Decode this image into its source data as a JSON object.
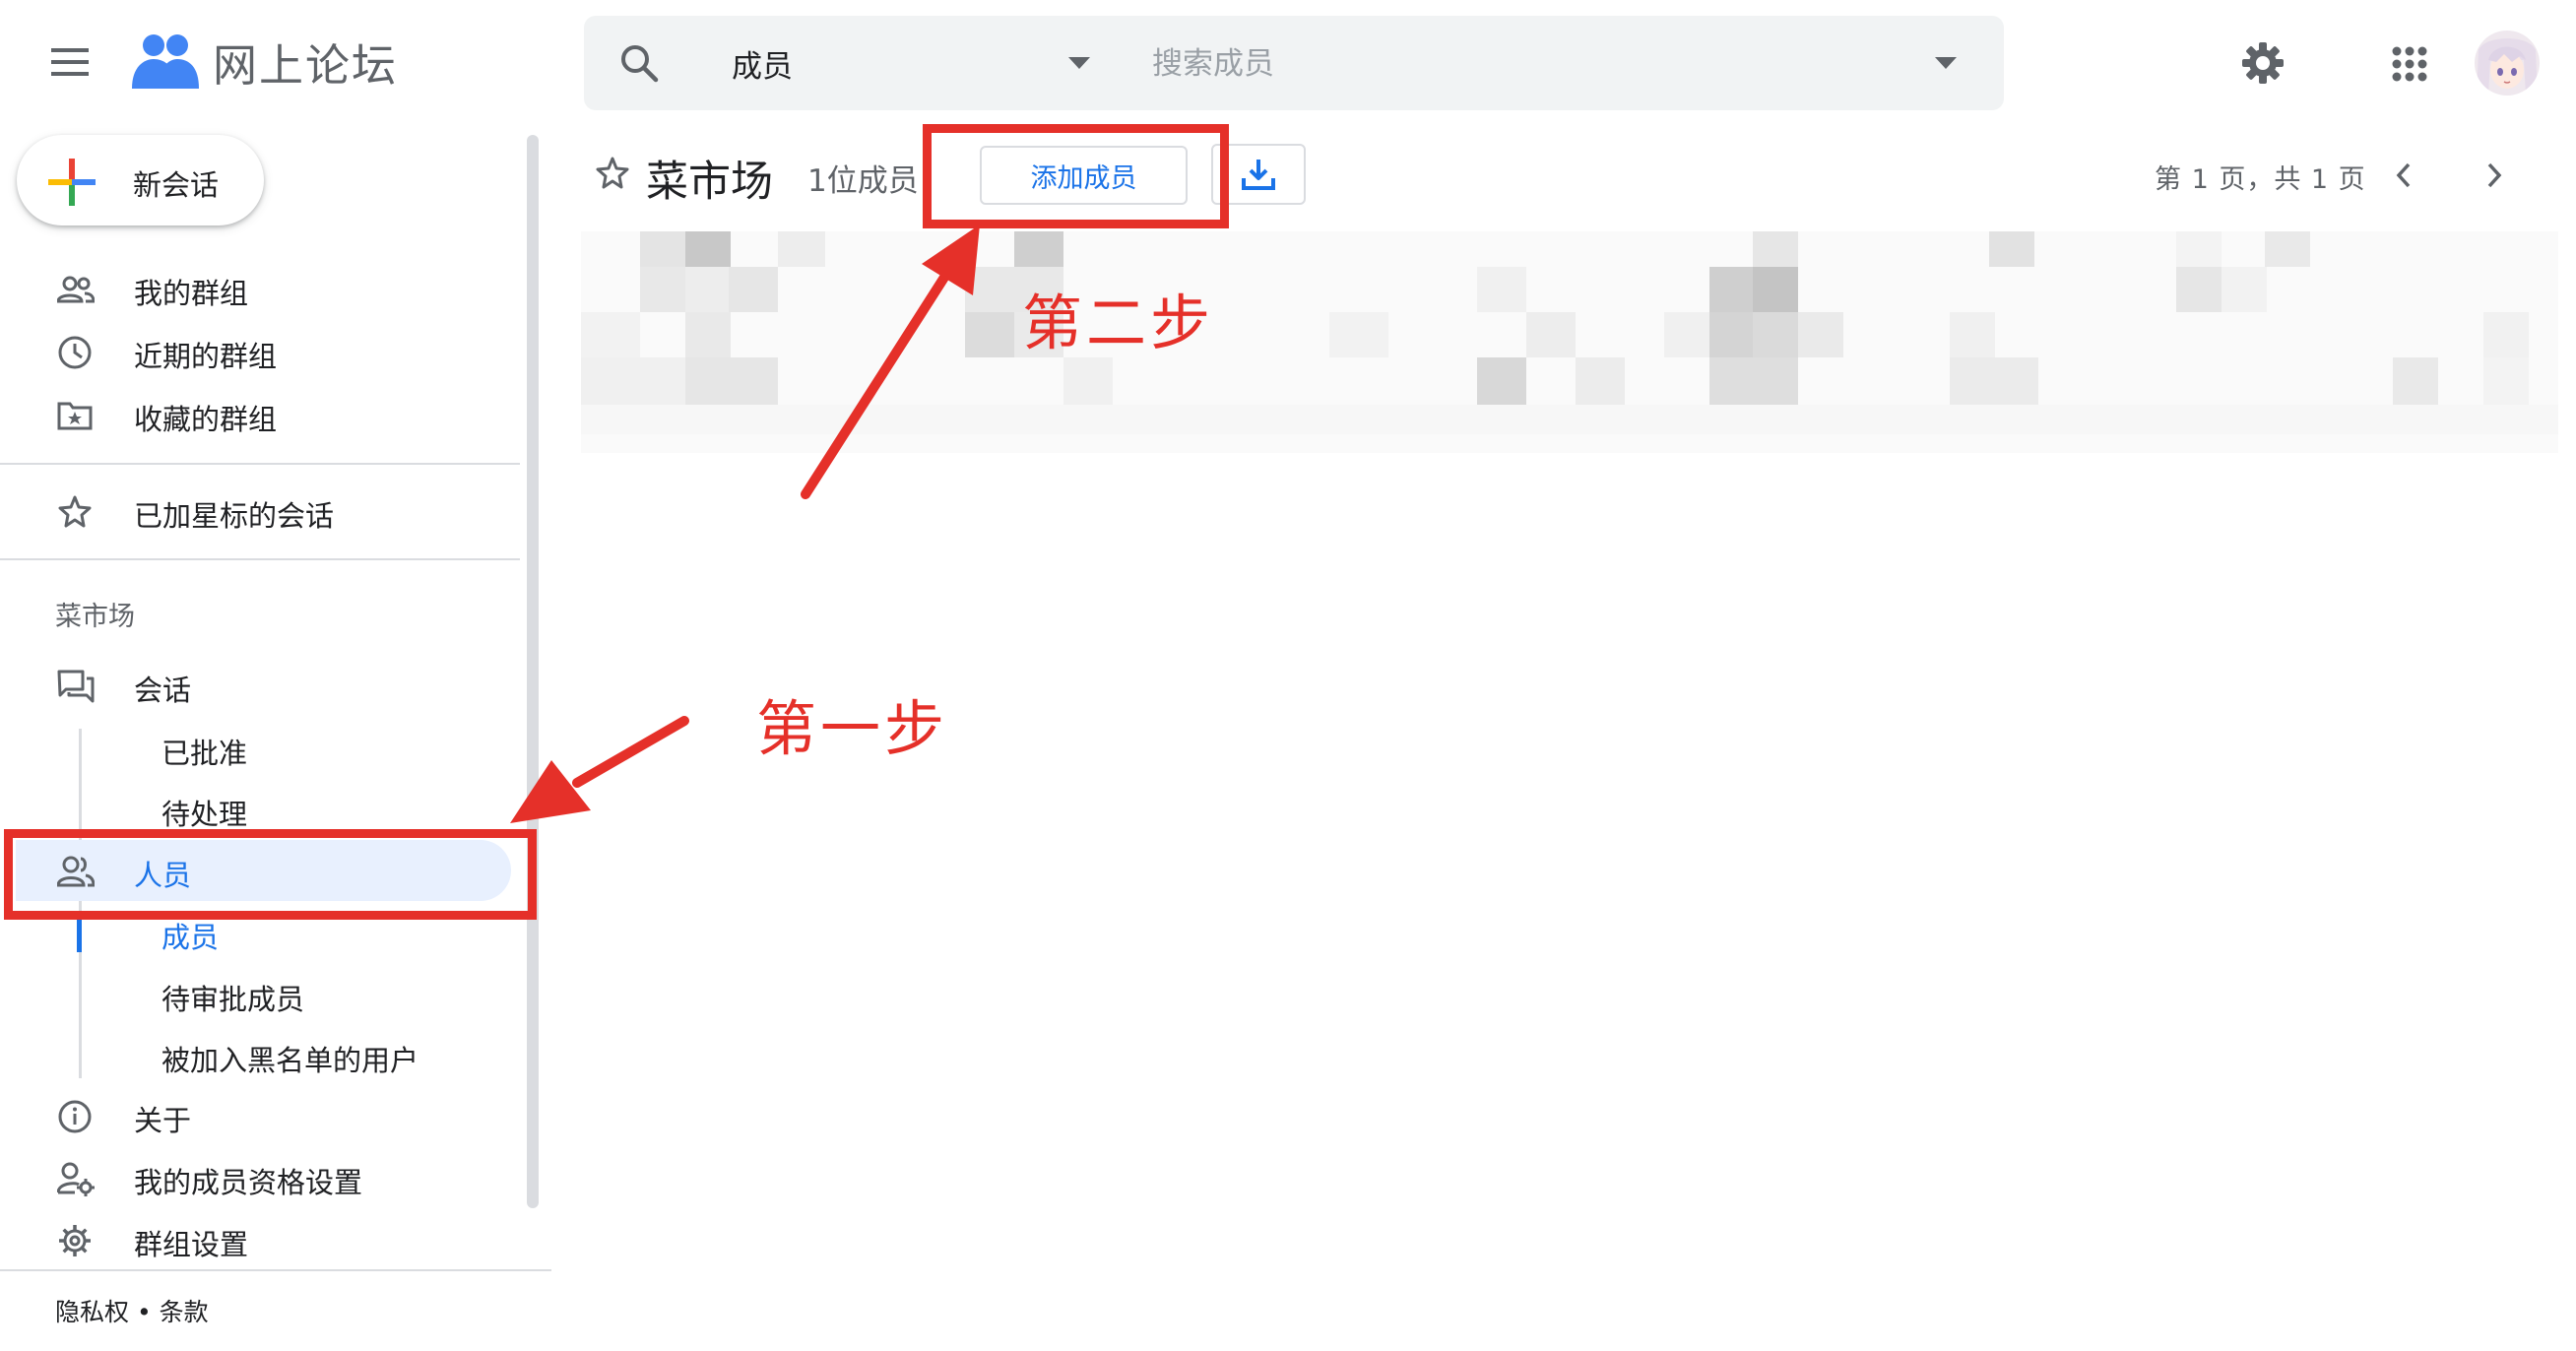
{
  "app": {
    "title": "网上论坛",
    "menu_icon": "hamburger-menu-icon",
    "logo_icon": "people-logo-icon"
  },
  "search": {
    "scope": "成员",
    "placeholder": "搜索成员",
    "search_icon": "search-icon",
    "scope_dropdown_icon": "caret-down-icon",
    "options_dropdown_icon": "caret-down-icon"
  },
  "header_right": {
    "settings_icon": "gear-icon",
    "apps_icon": "apps-grid-icon",
    "avatar_icon": "user-avatar"
  },
  "sidebar": {
    "new_chat": "新会话",
    "items": [
      {
        "label": "我的群组",
        "icon": "groups-icon"
      },
      {
        "label": "近期的群组",
        "icon": "clock-icon"
      },
      {
        "label": "收藏的群组",
        "icon": "folder-star-icon"
      }
    ],
    "starred": {
      "label": "已加星标的会话",
      "icon": "star-outline-icon"
    },
    "section_title": "菜市场",
    "chats": {
      "label": "会话",
      "icon": "forum-icon"
    },
    "chats_sub": [
      "已批准",
      "待处理"
    ],
    "people": {
      "label": "人员",
      "icon": "people-icon"
    },
    "people_sub": [
      "成员",
      "待审批成员",
      "被加入黑名单的用户"
    ],
    "about": {
      "label": "关于",
      "icon": "info-icon"
    },
    "membership": {
      "label": "我的成员资格设置",
      "icon": "person-settings-icon"
    },
    "group_settings": {
      "label": "群组设置",
      "icon": "gear-icon"
    },
    "footer": "隐私权 • 条款"
  },
  "main": {
    "group_name": "菜市场",
    "member_count": "1位成员",
    "add_member": "添加成员",
    "pagination": "第 1 页，共 1 页"
  },
  "annotations": {
    "step1": "第一步",
    "step2": "第二步",
    "color": "#e53029"
  },
  "colors": {
    "accent": "#1a73e8",
    "selected_bg": "#e8f0fe",
    "annotation": "#e53029"
  }
}
